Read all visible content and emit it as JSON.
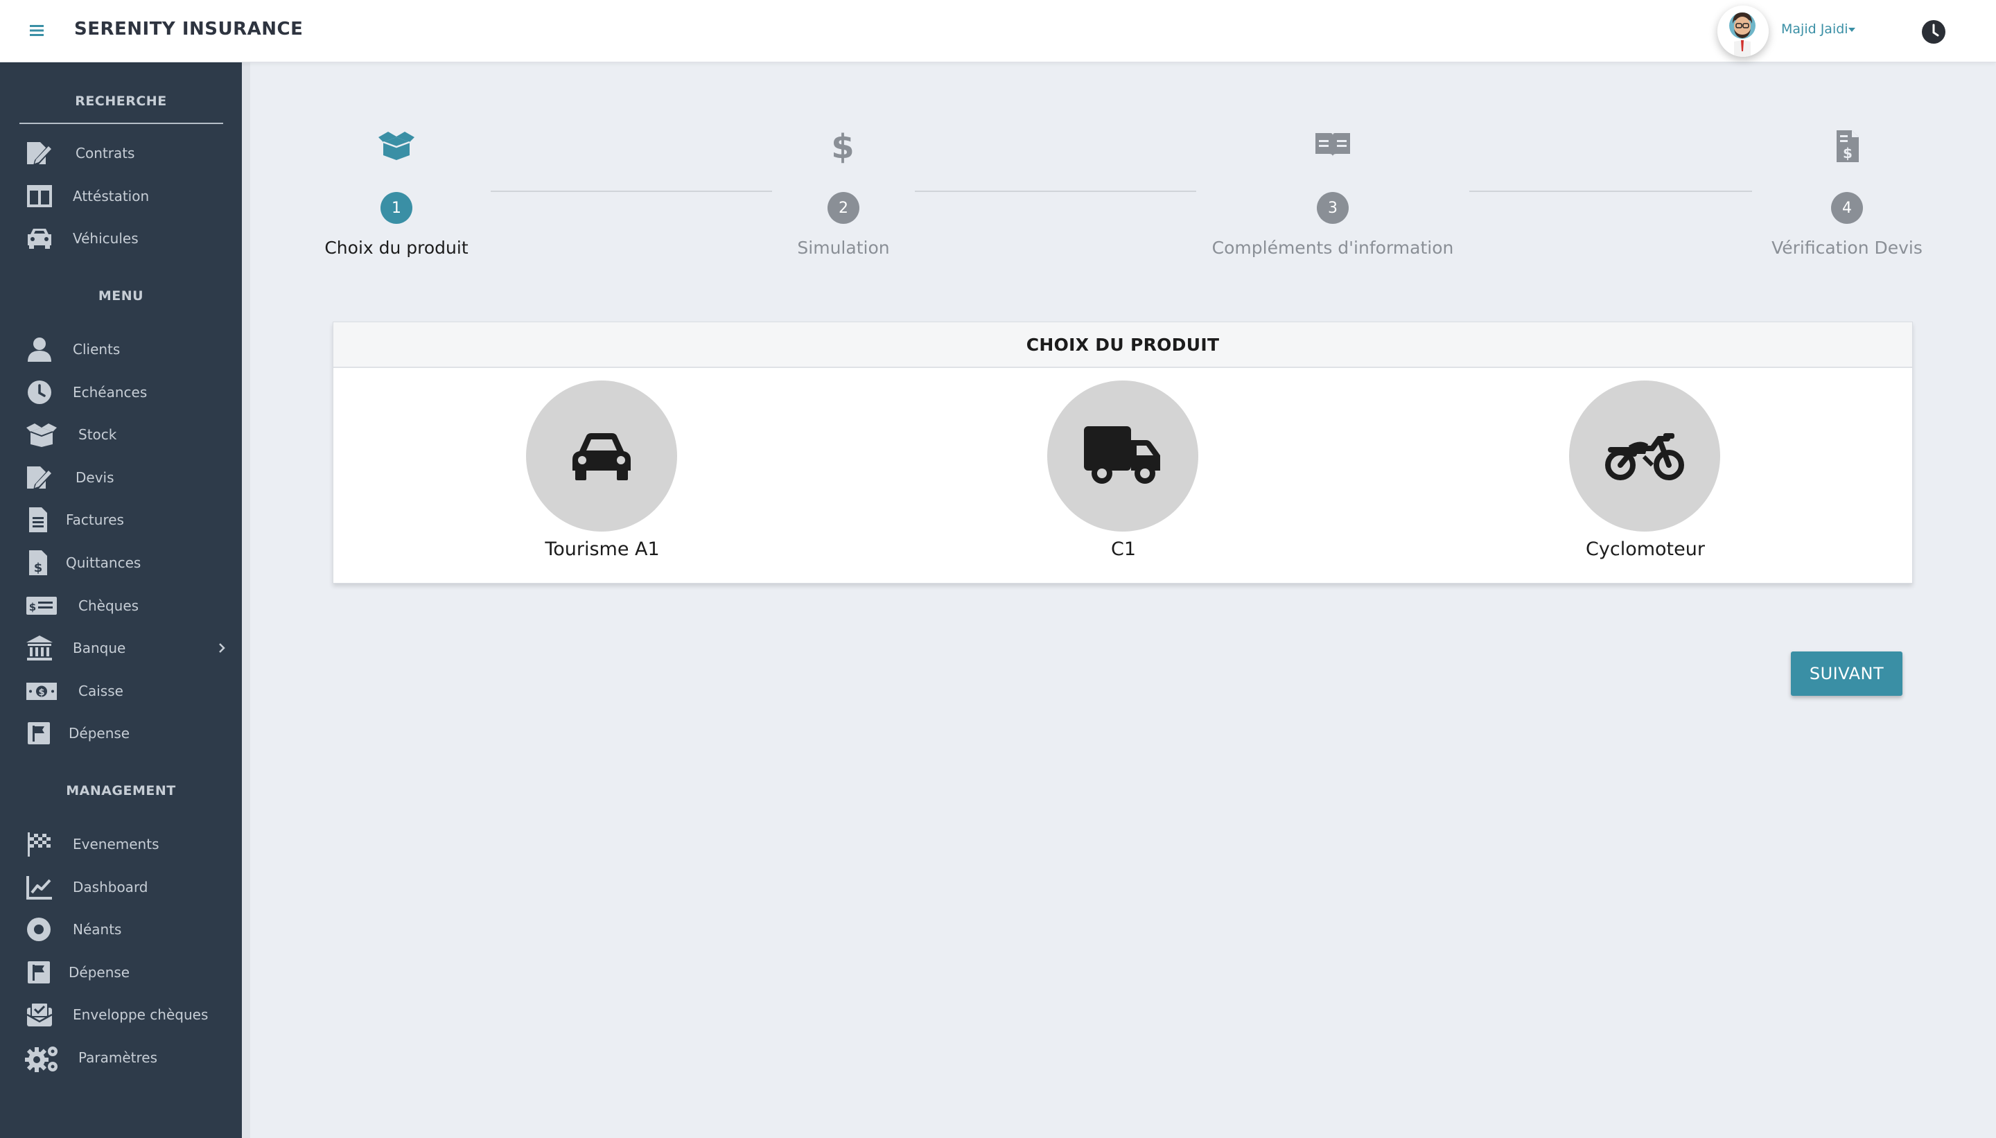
{
  "app": {
    "brand": "SERENITY INSURANCE"
  },
  "header": {
    "user_name": "Majid Jaidi",
    "icons": [
      "menu-icon",
      "user-avatar",
      "chevron-down-icon",
      "clock-icon"
    ]
  },
  "sidebar": {
    "sections": [
      {
        "title": "RECHERCHE"
      },
      {
        "title": "MENU"
      },
      {
        "title": "MANAGEMENT"
      }
    ],
    "recherche": [
      {
        "label": "Contrats",
        "icon": "edit-document-icon"
      },
      {
        "label": "Attéstation",
        "icon": "columns-icon"
      },
      {
        "label": "Véhicules",
        "icon": "car-icon"
      }
    ],
    "menu": [
      {
        "label": "Clients",
        "icon": "user-icon"
      },
      {
        "label": "Echéances",
        "icon": "clock-icon"
      },
      {
        "label": "Stock",
        "icon": "box-open-icon"
      },
      {
        "label": "Devis",
        "icon": "edit-document-icon"
      },
      {
        "label": "Factures",
        "icon": "file-lines-icon"
      },
      {
        "label": "Quittances",
        "icon": "file-dollar-icon"
      },
      {
        "label": "Chèques",
        "icon": "money-check-icon"
      },
      {
        "label": "Banque",
        "icon": "bank-icon"
      },
      {
        "label": "Caisse",
        "icon": "money-bill-icon"
      },
      {
        "label": "Dépense",
        "icon": "flag-icon"
      }
    ],
    "management": [
      {
        "label": "Evenements",
        "icon": "checkered-flag-icon"
      },
      {
        "label": "Dashboard",
        "icon": "chart-line-icon"
      },
      {
        "label": "Néants",
        "icon": "record-icon"
      },
      {
        "label": "Dépense",
        "icon": "flag-icon"
      },
      {
        "label": "Enveloppe chèques",
        "icon": "envelope-check-icon"
      },
      {
        "label": "Paramètres",
        "icon": "gears-icon"
      }
    ]
  },
  "stepper": {
    "current": 1,
    "steps": [
      {
        "number": "1",
        "label": "Choix du produit",
        "icon": "box-open-icon"
      },
      {
        "number": "2",
        "label": "Simulation",
        "icon": "dollar-icon"
      },
      {
        "number": "3",
        "label": "Compléments d'information",
        "icon": "open-book-icon"
      },
      {
        "number": "4",
        "label": "Vérification Devis",
        "icon": "file-invoice-dollar-icon"
      }
    ]
  },
  "product_card": {
    "title": "CHOIX DU PRODUIT",
    "products": [
      {
        "label": "Tourisme A1",
        "icon": "car-icon"
      },
      {
        "label": "C1",
        "icon": "truck-icon"
      },
      {
        "label": "Cyclomoteur",
        "icon": "motorcycle-icon"
      }
    ]
  },
  "actions": {
    "next_label": "SUIVANT"
  },
  "colors": {
    "accent": "#3a8fa5",
    "sidebar_bg": "#2e3b4a",
    "page_bg": "#ebeef3",
    "inactive_step": "#8a8f96"
  }
}
